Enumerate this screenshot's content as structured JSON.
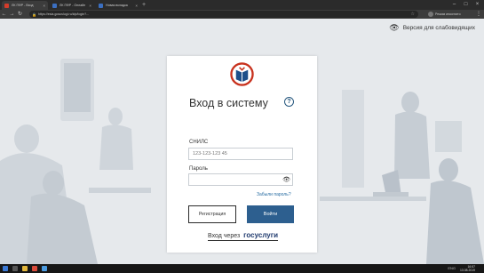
{
  "browser": {
    "tabs": [
      {
        "title": "ЛК ПФР - Вход",
        "color": "#d43c2b",
        "active": true
      },
      {
        "title": "ЛК ПФР - Онлайн",
        "color": "#3b6fc1",
        "active": false
      },
      {
        "title": "Новая вкладка",
        "color": "#3b6fc1",
        "active": false
      }
    ],
    "url": "https://esia.gosuslugi.ru/idp/login?...",
    "incognito_label": "Режим инкогнито"
  },
  "page": {
    "vision_mode_label": "Версия для слабовидящих",
    "form": {
      "title": "Вход в систему",
      "help_symbol": "?",
      "snils_label": "СНИЛС",
      "snils_placeholder": "123-123-123 45",
      "password_label": "Пароль",
      "forgot_link": "Забыли пароль?",
      "register_button": "Регистрация",
      "login_button": "Войти",
      "gosuslugi_prefix": "Вход через",
      "gosuslugi_brand": "госуслуги"
    }
  },
  "taskbar": {
    "time": "16:57",
    "date": "13.08.2019",
    "tray": "ENG"
  },
  "colors": {
    "primary": "#2d5f8f",
    "logo_red": "#c8321e",
    "logo_blue": "#1d4f8a",
    "background": "#e6e9ec"
  }
}
